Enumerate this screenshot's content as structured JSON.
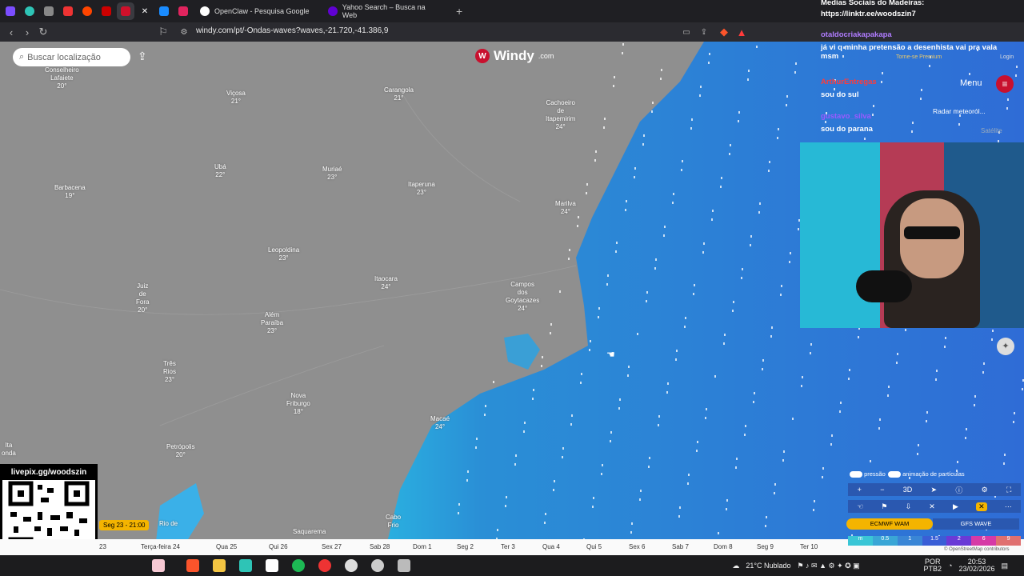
{
  "browser": {
    "tabs": [
      {
        "label": "OpenClaw - Pesquisa Google"
      },
      {
        "label": "Yahoo Search – Busca na Web"
      }
    ],
    "url": "windy.com/pt/-Ondas-waves?waves,-21.720,-41.386,9"
  },
  "map": {
    "search_placeholder": "Buscar localização",
    "logo_text": "Windy",
    "logo_suffix": ".com",
    "cities": [
      {
        "name": "Conselheiro\nLafaiete",
        "temp": "20°"
      },
      {
        "name": "Viçosa",
        "temp": "21°"
      },
      {
        "name": "Carangola",
        "temp": "21°"
      },
      {
        "name": "Cachoeiro\nde\nItapemirim",
        "temp": "24°"
      },
      {
        "name": "Barbacena",
        "temp": "19°"
      },
      {
        "name": "Ubá",
        "temp": "22°"
      },
      {
        "name": "Muriaé",
        "temp": "23°"
      },
      {
        "name": "Itaperuna",
        "temp": "23°"
      },
      {
        "name": "Marilva",
        "temp": "24°"
      },
      {
        "name": "Leopoldina",
        "temp": "23°"
      },
      {
        "name": "Juiz\nde\nFora",
        "temp": "20°"
      },
      {
        "name": "Itaocara",
        "temp": "24°"
      },
      {
        "name": "Campos\ndos\nGoytacazes",
        "temp": "24°"
      },
      {
        "name": "Além\nParaíba",
        "temp": "23°"
      },
      {
        "name": "Três\nRios",
        "temp": "23°"
      },
      {
        "name": "Nova\nFriburgo",
        "temp": "18°"
      },
      {
        "name": "Macaé",
        "temp": "24°"
      },
      {
        "name": "Petrópolis",
        "temp": "20°"
      },
      {
        "name": "Cabo\nFrio",
        "temp": ""
      },
      {
        "name": "Saquarema",
        "temp": ""
      },
      {
        "name": "Rio de",
        "temp": ""
      },
      {
        "name": "Ita\nonda",
        "temp": ""
      }
    ]
  },
  "chat": {
    "header1": "Medias Sociais do Madeiras:",
    "header2": "https://linktr.ee/woodszin7",
    "messages": [
      {
        "user": "otaldocriakapakapa",
        "text": "já vi q minha pretensão a desenhista vai pra vala msm",
        "color": "#b07cff"
      },
      {
        "user": "ArthurEntregas",
        "text": "sou do sul",
        "color": "#ff3b3b"
      },
      {
        "user": "gustavo_silva",
        "text": "sou do parana",
        "color": "#9b59ff"
      }
    ],
    "overlay": {
      "premium": "Torne-se Premium",
      "login": "Login",
      "menu": "Menu",
      "radar": "Radar meteoról...",
      "satellite": "Satélite"
    }
  },
  "qr": {
    "label": "livepix.gg/woodszin"
  },
  "timeline": {
    "current": "Seg 23 - 21:00",
    "days": [
      "23",
      "Terça-feira 24",
      "Qua 25",
      "Qui 26",
      "Sex 27",
      "Sab 28",
      "Dom 1",
      "Seg 2",
      "Ter 3",
      "Qua 4",
      "Qui 5",
      "Sex 6",
      "Sab 7",
      "Dom 8",
      "Seg 9",
      "Ter 10"
    ]
  },
  "controls": {
    "pressure": "pressão",
    "particles": "animação de partículas",
    "mode3d": "3D",
    "model1": "ECMWF WAM",
    "model2": "GFS WAVE",
    "legend": [
      "m",
      "0.5",
      "1",
      "1.5",
      "2",
      "6",
      "9"
    ],
    "attribution": "© OpenStreetMap contributors"
  },
  "taskbar": {
    "weather": "21°C  Nublado",
    "lang1": "POR",
    "lang2": "PTB2",
    "time": "20:53",
    "date": "23/02/2026"
  }
}
